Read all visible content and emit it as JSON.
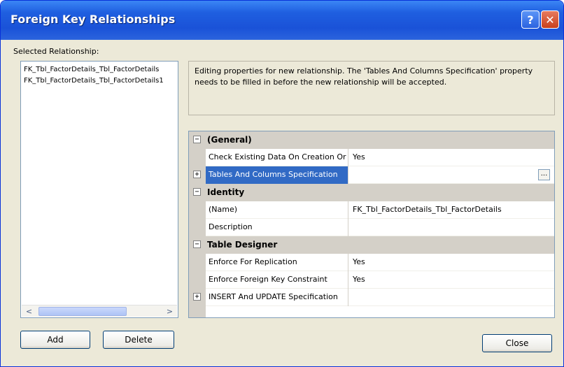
{
  "window": {
    "title": "Foreign Key Relationships",
    "help_glyph": "?",
    "close_glyph": "✕"
  },
  "left_panel": {
    "label": "Selected Relationship:",
    "relationships": [
      "FK_Tbl_FactorDetails_Tbl_FactorDetails",
      "FK_Tbl_FactorDetails_Tbl_FactorDetails1"
    ],
    "scroll_left": "<",
    "scroll_right": ">"
  },
  "buttons": {
    "add": "Add",
    "delete": "Delete",
    "close": "Close"
  },
  "info_text": "Editing properties for new relationship.  The 'Tables And Columns Specification' property needs to be filled in before the new relationship will be accepted.",
  "grid": {
    "general": {
      "label": "(General)",
      "check_existing_name": "Check Existing Data On Creation Or Re-Enabling",
      "check_existing_value": "Yes",
      "tables_columns_name": "Tables And Columns Specification",
      "tables_columns_ellipsis": "..."
    },
    "identity": {
      "label": "Identity",
      "name_label": "(Name)",
      "name_value": "FK_Tbl_FactorDetails_Tbl_FactorDetails",
      "description_label": "Description",
      "description_value": ""
    },
    "table_designer": {
      "label": "Table Designer",
      "enforce_replication_name": "Enforce For Replication",
      "enforce_replication_value": "Yes",
      "enforce_fk_name": "Enforce Foreign Key Constraint",
      "enforce_fk_value": "Yes",
      "insert_update_name": "INSERT And UPDATE Specification"
    },
    "collapse_glyph": "−",
    "expand_glyph": "+"
  }
}
